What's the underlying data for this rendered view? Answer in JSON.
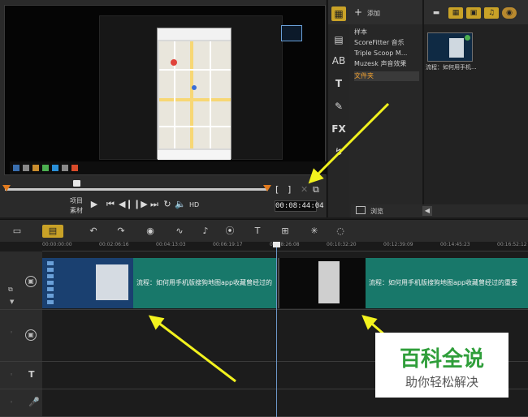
{
  "preview": {
    "mode_labels": [
      "项目",
      "素材"
    ],
    "hd_label": "HD",
    "timecode": "00:08:44:04",
    "bracket_in": "[",
    "bracket_out": "]"
  },
  "library": {
    "add_label": "添加",
    "items": [
      "样本",
      "ScoreFitter 音乐",
      "Triple Scoop M...",
      "Muzesk 声音效果",
      "文件夹"
    ],
    "selected_index": 4,
    "thumb_caption": "流程：如何用手机...",
    "browse_label": "浏览"
  },
  "timeline": {
    "ruler_ticks": [
      "00:00:00:00",
      "00:02:06:16",
      "00:04:13:03",
      "00:06:19:17",
      "00:08:26:08",
      "00:10:32:20",
      "00:12:39:09",
      "00:14:45:23",
      "00:16:52:12"
    ],
    "clip1_title": "流程：如何用手机版搜狗地图app收藏曾经过的",
    "clip2_title": "流程：如何用手机版搜狗地图app收藏曾经过的重要"
  },
  "watermark": {
    "main": "百科全说",
    "sub": "助你轻松解决"
  },
  "colors": {
    "accent_orange": "#f0a030",
    "clip_teal": "#18786a",
    "annotation_yellow": "#f2f21e",
    "watermark_green": "#2f9e3a"
  }
}
